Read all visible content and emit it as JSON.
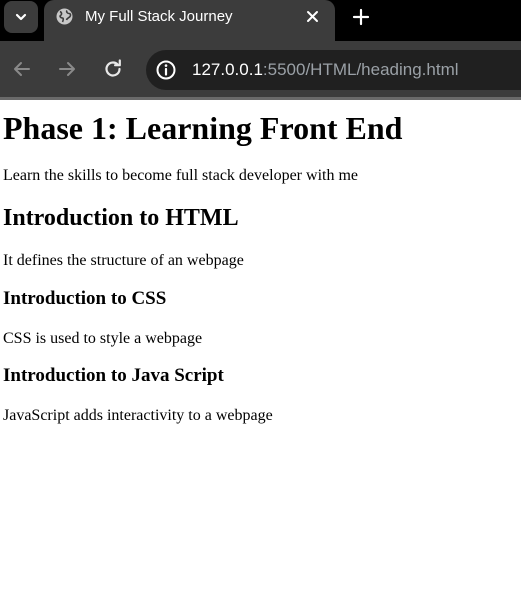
{
  "browser": {
    "tab": {
      "title": "My Full Stack Journey",
      "favicon": "globe-icon"
    },
    "address_bar": {
      "host": "127.0.0.1",
      "rest": ":5500/HTML/heading.html"
    },
    "icons": {
      "tab_menu": "chevron-down-icon",
      "close_tab": "close-icon",
      "new_tab": "plus-icon",
      "back": "arrow-left-icon",
      "forward": "arrow-right-icon",
      "reload": "reload-icon",
      "site_info": "site-info-icon"
    }
  },
  "page": {
    "h1": "Phase 1: Learning Front End",
    "intro": "Learn the skills to become full stack developer with me",
    "sections": [
      {
        "heading": "Introduction to HTML",
        "text": "It defines the structure of an webpage"
      },
      {
        "heading": "Introduction to CSS",
        "text": "CSS is used to style a webpage"
      },
      {
        "heading": "Introduction to Java Script",
        "text": "JavaScript adds interactivity to a webpage"
      }
    ]
  },
  "colors": {
    "tabstrip": "#000000",
    "toolbar": "#3c3c3c",
    "omnibox": "#202020",
    "url_muted": "#9aa0a6",
    "page_bg": "#ffffff",
    "text": "#000000"
  }
}
